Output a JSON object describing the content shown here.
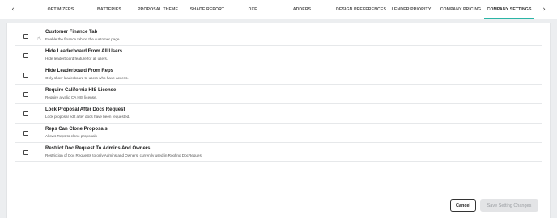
{
  "tabbar": {
    "prev_glyph": "‹",
    "tabs": [
      {
        "label": "OPTIMIZERS",
        "active": false
      },
      {
        "label": "BATTERIES",
        "active": false
      },
      {
        "label": "PROPOSAL THEME",
        "active": false
      },
      {
        "label": "SHADE REPORT",
        "active": false
      },
      {
        "label": "DXF",
        "active": false
      },
      {
        "label": "ADDERS",
        "active": false
      },
      {
        "label": "DESIGN PREFERENCES",
        "active": false
      },
      {
        "label": "LENDER PRIORITY",
        "active": false
      },
      {
        "label": "COMPANY PRICING",
        "active": false
      },
      {
        "label": "COMPANY SETTINGS",
        "active": true
      }
    ],
    "next_glyph": "›"
  },
  "settings": [
    {
      "title": "Customer Finance Tab",
      "description": "Enable the finance tab on the customer page.",
      "checked": false
    },
    {
      "title": "Hide Leaderboard From All Users",
      "description": "Hide leaderboard feature for all users.",
      "checked": false
    },
    {
      "title": "Hide Leaderboard From Reps",
      "description": "Only show leaderboard to users who have access.",
      "checked": false
    },
    {
      "title": "Require California HIS License",
      "description": "Require a valid CA HIS license.",
      "checked": false
    },
    {
      "title": "Lock Proposal After Docs Request",
      "description": "Lock proposal edit after docs have been requested.",
      "checked": false
    },
    {
      "title": "Reps Can Clone Proposals",
      "description": "Allows Reps to clone proposals",
      "checked": false
    },
    {
      "title": "Restrict Doc Request To Admins And Owners",
      "description": "Restriction of Doc Requests to only Admins and Owners, currently used in Roofing DocRequest",
      "checked": false
    }
  ],
  "footer": {
    "cancel_label": "Cancel",
    "save_label": "Save Setting Changes"
  },
  "icons": {
    "cursor": "pointer-hand-icon"
  }
}
